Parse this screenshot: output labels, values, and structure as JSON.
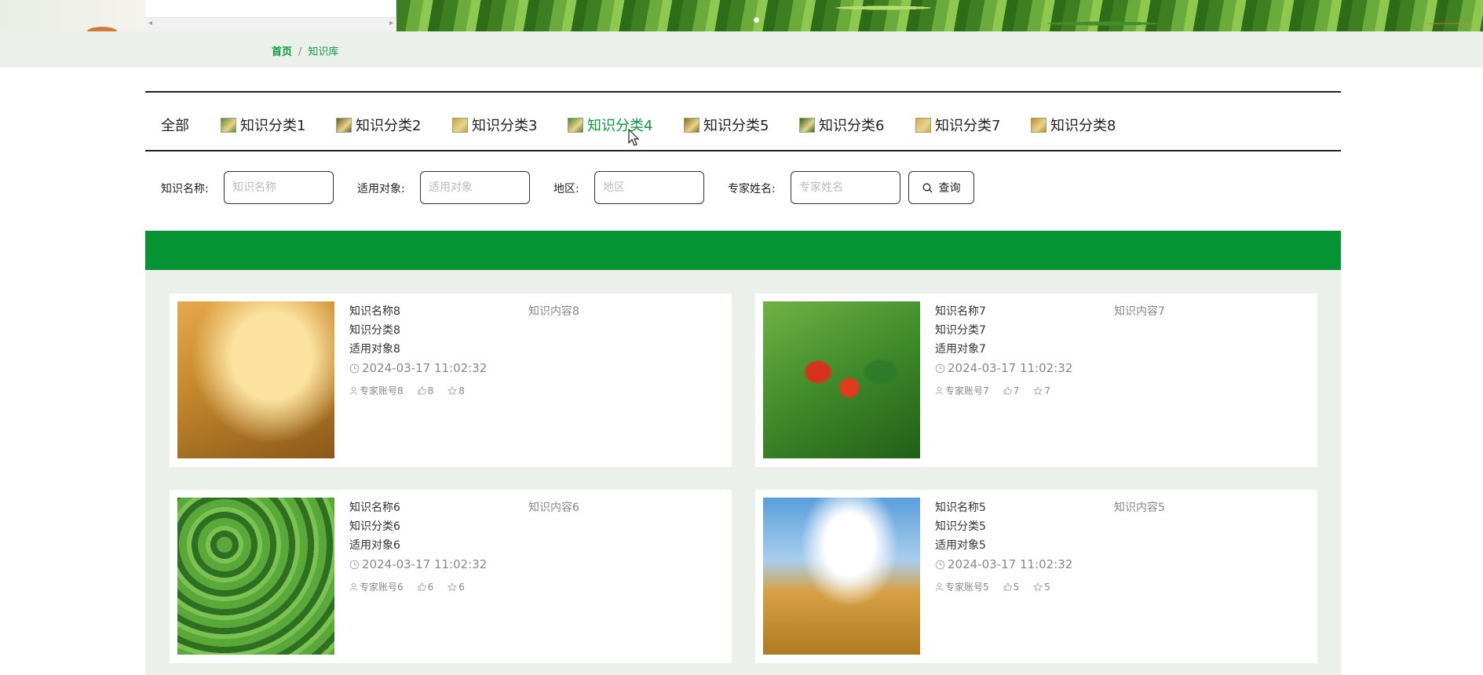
{
  "breadcrumb": {
    "home": "首页",
    "separator": "/",
    "current": "知识库"
  },
  "categories": [
    {
      "label": "全部",
      "active": false,
      "thumb": ""
    },
    {
      "label": "知识分类1",
      "active": false,
      "thumb": "#5b8a2a"
    },
    {
      "label": "知识分类2",
      "active": false,
      "thumb": "#6b5a2a"
    },
    {
      "label": "知识分类3",
      "active": false,
      "thumb": "#c9a23a"
    },
    {
      "label": "知识分类4",
      "active": true,
      "thumb": "#4f7f3a"
    },
    {
      "label": "知识分类5",
      "active": false,
      "thumb": "#8a6a2a"
    },
    {
      "label": "知识分类6",
      "active": false,
      "thumb": "#2f5f1f"
    },
    {
      "label": "知识分类7",
      "active": false,
      "thumb": "#d9a650"
    },
    {
      "label": "知识分类8",
      "active": false,
      "thumb": "#c2882a"
    }
  ],
  "search": {
    "name_label": "知识名称:",
    "name_placeholder": "知识名称",
    "target_label": "适用对象:",
    "target_placeholder": "适用对象",
    "region_label": "地区:",
    "region_placeholder": "地区",
    "expert_label": "专家姓名:",
    "expert_placeholder": "专家姓名",
    "button_label": "查询"
  },
  "colors": {
    "accent": "#059334",
    "link": "#0a9a3c",
    "strip": "#ecf0eb"
  },
  "cards": [
    {
      "name": "知识名称8",
      "category": "知识分类8",
      "target": "适用对象8",
      "content": "知识内容8",
      "date": "2024-03-17 11:02:32",
      "expert": "专家账号8",
      "likes": "8",
      "favorites": "8",
      "image": "wheat"
    },
    {
      "name": "知识名称7",
      "category": "知识分类7",
      "target": "适用对象7",
      "content": "知识内容7",
      "date": "2024-03-17 11:02:32",
      "expert": "专家账号7",
      "likes": "7",
      "favorites": "7",
      "image": "pepper"
    },
    {
      "name": "知识名称6",
      "category": "知识分类6",
      "target": "适用对象6",
      "content": "知识内容6",
      "date": "2024-03-17 11:02:32",
      "expert": "专家账号6",
      "likes": "6",
      "favorites": "6",
      "image": "soy"
    },
    {
      "name": "知识名称5",
      "category": "知识分类5",
      "target": "适用对象5",
      "content": "知识内容5",
      "date": "2024-03-17 11:02:32",
      "expert": "专家账号5",
      "likes": "5",
      "favorites": "5",
      "image": "corn"
    }
  ]
}
